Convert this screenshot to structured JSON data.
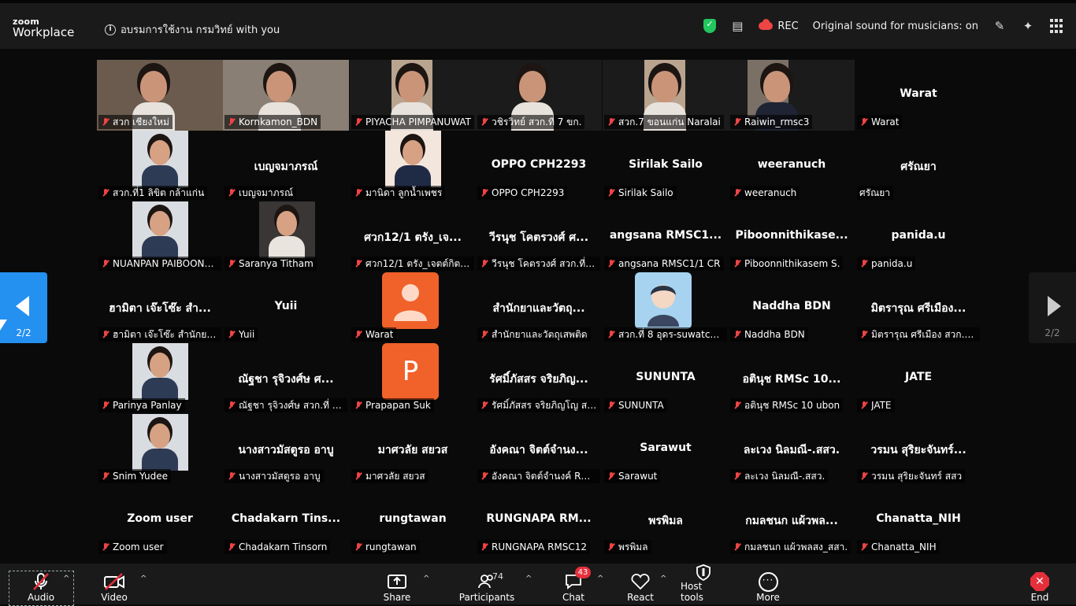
{
  "app": {
    "logo_line1": "zoom",
    "logo_line2": "Workplace"
  },
  "meeting": {
    "title": "อบรมการใช้งาน กรมวิทย์ with you"
  },
  "topbar": {
    "rec_label": "REC",
    "original_sound": "Original sound for musicians: on"
  },
  "pager": {
    "left": "2/2",
    "right": "2/2"
  },
  "rows": [
    [
      {
        "label": "สวก เชียงใหม่",
        "type": "video"
      },
      {
        "label": "Kornkamon_BDN",
        "type": "video"
      },
      {
        "label": "PIYACHA PIMPANUWAT",
        "type": "video"
      },
      {
        "label": "วชิรวิทย์ สวก.ที่ 7 ขก.",
        "type": "video"
      },
      {
        "label": "สวก.7 ขอนแก่น Naralai",
        "type": "video"
      },
      {
        "label": "Raiwin_rmsc3",
        "type": "video"
      },
      {
        "label": "Warat",
        "big": "Warat",
        "type": "name"
      }
    ],
    [
      {
        "label": "สวก.ที่1 ลิขิต กล้าแก่น",
        "type": "photo"
      },
      {
        "label": "เบญจมาภรณ์",
        "big": "เบญจมาภรณ์",
        "type": "name"
      },
      {
        "label": "มานิดา ลูกน้ำเพชร",
        "type": "photo"
      },
      {
        "label": "OPPO CPH2293",
        "big": "OPPO CPH2293",
        "type": "name"
      },
      {
        "label": "Sirilak Sailo",
        "big": "Sirilak Sailo",
        "type": "name"
      },
      {
        "label": "weeranuch",
        "big": "weeranuch",
        "type": "name"
      },
      {
        "label": "ศรัณยา",
        "big": "ศรัณยา",
        "type": "name",
        "nomute": true
      }
    ],
    [
      {
        "label": "NUANPAN PAIBOONS...",
        "type": "photo"
      },
      {
        "label": "Saranya Titham",
        "type": "photo"
      },
      {
        "label": "ศวก12/1 ตรัง_เจตต์กิตต์...",
        "big": "ศวก12/1 ตรัง_เจ...",
        "type": "name"
      },
      {
        "label": "วีรนุช โคตรวงศ์ สวก.ที่ 8 ...",
        "big": "วีรนุช โคตรวงศ์ ศ...",
        "type": "name"
      },
      {
        "label": "angsana RMSC1/1 CR",
        "big": "angsana  RMSC1...",
        "type": "name"
      },
      {
        "label": "Piboonnithikasem S.",
        "big": "Piboonnithikase...",
        "type": "name"
      },
      {
        "label": "panida.u",
        "big": "panida.u",
        "type": "name"
      }
    ],
    [
      {
        "label": "ฮามิตา เจ๊ะโซ๊ะ สำนักยาแล...",
        "big": "ฮามิตา เจ๊ะโซ๊ะ สำ...",
        "type": "name"
      },
      {
        "label": "Yuii",
        "big": "Yuii",
        "type": "name"
      },
      {
        "label": "Warat",
        "type": "avatar-person"
      },
      {
        "label": "สำนักยาและวัตถุเสพติด",
        "big": "สำนักยาและวัตถุ...",
        "type": "name"
      },
      {
        "label": "สวก.ที่ 8 อุดร-suwatcha...",
        "type": "avatar-cartoon"
      },
      {
        "label": "Naddha BDN",
        "big": "Naddha BDN",
        "type": "name"
      },
      {
        "label": "มิตรารุณ ศรีเมือง สวก.ตรัง",
        "big": "มิตรารุณ ศรีเมือง...",
        "type": "name"
      }
    ],
    [
      {
        "label": "Parinya Panlay",
        "type": "photo"
      },
      {
        "label": "ณัฐชา รุจิวงศ์ษ สวก.ที่ 5 ...",
        "big": "ณัฐชา รุจิวงศ์ษ ศ...",
        "type": "name"
      },
      {
        "label": "Prapapan Suk",
        "type": "avatar-letter",
        "letter": "P"
      },
      {
        "label": "รัศมิ์ภัสสร จริยภิญโญ สสา.",
        "big": "รัศมิ์ภัสสร จริยภิญ...",
        "type": "name"
      },
      {
        "label": "SUNUNTA",
        "big": "SUNUNTA",
        "type": "name"
      },
      {
        "label": "อตินุช RMSc 10 ubon",
        "big": "อตินุช RMSc 10...",
        "type": "name"
      },
      {
        "label": "JATE",
        "big": "JATE",
        "type": "name"
      }
    ],
    [
      {
        "label": "Snim Yudee",
        "type": "photo"
      },
      {
        "label": "นางสาวมัสตูรอ อาบู",
        "big": "นางสาวมัสตูรอ อาบู",
        "type": "name"
      },
      {
        "label": "มาศวลัย สยวส",
        "big": "มาศวลัย สยวส",
        "type": "name"
      },
      {
        "label": "อังคณา จิตต์จำนงค์ RMS...",
        "big": "อังคณา จิตต์จำนง...",
        "type": "name"
      },
      {
        "label": "Sarawut",
        "big": "Sarawut",
        "type": "name"
      },
      {
        "label": "ละเวง นิลมณี-.สสว.",
        "big": "ละเวง นิลมณี-.สสว.",
        "type": "name"
      },
      {
        "label": "วรมน สุริยะจันทร์ สสว",
        "big": "วรมน สุริยะจันทร์...",
        "type": "name"
      }
    ],
    [
      {
        "label": "Zoom user",
        "big": "Zoom user",
        "type": "name"
      },
      {
        "label": "Chadakarn Tinsorn",
        "big": "Chadakarn  Tins...",
        "type": "name"
      },
      {
        "label": "rungtawan",
        "big": "rungtawan",
        "type": "name"
      },
      {
        "label": "RUNGNAPA RMSC12",
        "big": "RUNGNAPA  RM...",
        "type": "name"
      },
      {
        "label": "พรพิมล",
        "big": "พรพิมล",
        "type": "name"
      },
      {
        "label": "กมลชนก แผ้วพลสง_สสา.",
        "big": "กมลชนก แผ้วพล...",
        "type": "name"
      },
      {
        "label": "Chanatta_NIH",
        "big": "Chanatta_NIH",
        "type": "name"
      }
    ]
  ],
  "toolbar": {
    "audio": "Audio",
    "video": "Video",
    "share": "Share",
    "participants": "Participants",
    "participants_count": "74",
    "chat": "Chat",
    "chat_badge": "43",
    "react": "React",
    "host_tools": "Host tools",
    "more": "More",
    "end": "End"
  },
  "colors": {
    "accent": "#2490f0",
    "end": "#e5303c",
    "avatar_orange": "#f1612a",
    "secure_green": "#22c55e"
  }
}
